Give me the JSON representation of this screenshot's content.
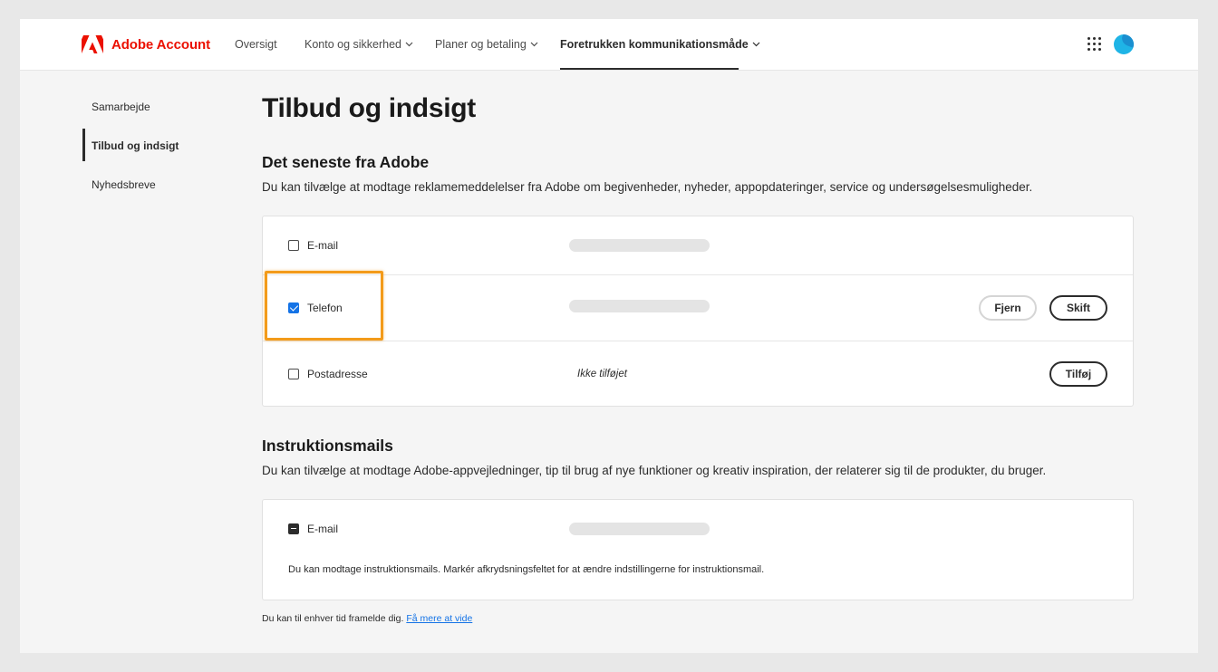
{
  "header": {
    "brand": "Adobe Account",
    "nav": [
      {
        "label": "Oversigt",
        "has_dropdown": false,
        "active": false
      },
      {
        "label": "Konto og sikkerhed",
        "has_dropdown": true,
        "active": false
      },
      {
        "label": "Planer og betaling",
        "has_dropdown": true,
        "active": false
      },
      {
        "label": "Foretrukken kommunikationsmåde",
        "has_dropdown": true,
        "active": true
      }
    ],
    "icons": [
      "adobe-logo-icon",
      "apps-grid-icon",
      "avatar"
    ]
  },
  "sidebar": {
    "items": [
      {
        "label": "Samarbejde",
        "active": false
      },
      {
        "label": "Tilbud og indsigt",
        "active": true
      },
      {
        "label": "Nyhedsbreve",
        "active": false
      }
    ]
  },
  "main": {
    "title": "Tilbud og indsigt",
    "offers": {
      "title": "Det seneste fra Adobe",
      "description": "Du kan tilvælge at modtage reklamemeddelelser fra Adobe om begivenheder, nyheder, appopdateringer, service og undersøgelsesmuligheder.",
      "rows": [
        {
          "label": "E-mail",
          "checked": false,
          "value": ""
        },
        {
          "label": "Telefon",
          "checked": true,
          "value": "",
          "buttons": [
            "Fjern",
            "Skift"
          ],
          "highlighted": true
        },
        {
          "label": "Postadresse",
          "checked": false,
          "status": "Ikke tilføjet",
          "buttons": [
            "Tilføj"
          ]
        }
      ]
    },
    "instructions": {
      "title": "Instruktionsmails",
      "description": "Du kan tilvælge at modtage Adobe-appvejledninger, tip til brug af nye funktioner og kreativ inspiration, der relaterer sig til de produkter, du bruger.",
      "rows": [
        {
          "label": "E-mail",
          "state": "indeterminate",
          "value": ""
        }
      ],
      "note": "Du kan modtage instruktionsmails. Markér afkrydsningsfeltet for at ændre indstillingerne for instruktionsmail."
    },
    "footer": {
      "text": "Du kan til enhver tid framelde dig.",
      "link": "Få mere at vide"
    }
  },
  "colors": {
    "brand_red": "#eb1000",
    "checkbox_blue": "#1473e6",
    "highlight_orange": "#f39b1a",
    "link_blue": "#1473e6"
  }
}
